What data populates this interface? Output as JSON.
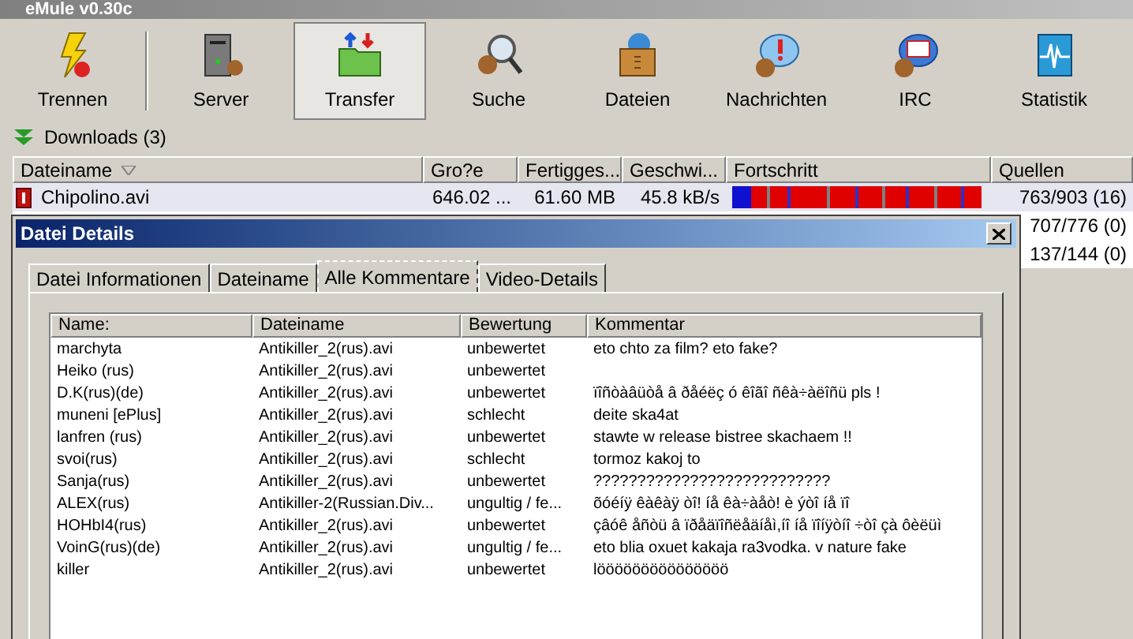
{
  "window": {
    "title": "eMule v0.30c"
  },
  "toolbar": [
    {
      "label": "Trennen",
      "selected": false
    },
    {
      "label": "Server",
      "selected": false
    },
    {
      "label": "Transfer",
      "selected": true
    },
    {
      "label": "Suche",
      "selected": false
    },
    {
      "label": "Dateien",
      "selected": false
    },
    {
      "label": "Nachrichten",
      "selected": false
    },
    {
      "label": "IRC",
      "selected": false
    },
    {
      "label": "Statistik",
      "selected": false
    }
  ],
  "downloads": {
    "label": "Downloads (3)",
    "columns": [
      "Dateiname",
      "Gro?e",
      "Fertigges...",
      "Geschwi...",
      "Fortschritt",
      "Quellen"
    ],
    "rows": [
      {
        "selected": true,
        "name": "Chipolino.avi",
        "size": "646.02 ...",
        "done": "61.60 MB",
        "speed": "45.8 kB/s",
        "sources": "763/903 (16)"
      },
      {
        "selected": false,
        "sources": "707/776 (0)"
      },
      {
        "selected": false,
        "sources": "137/144 (0)"
      }
    ]
  },
  "dialog": {
    "title": "Datei Details",
    "tabs": [
      {
        "label": "Datei Informationen",
        "selected": false
      },
      {
        "label": "Dateiname",
        "selected": false
      },
      {
        "label": "Alle Kommentare",
        "selected": true
      },
      {
        "label": "Video-Details",
        "selected": false
      }
    ],
    "columns": [
      "Name:",
      "Dateiname",
      "Bewertung",
      "Kommentar"
    ],
    "rows": [
      [
        "marchyta",
        "Antikiller_2(rus).avi",
        "unbewertet",
        "eto chto za film? eto fake?"
      ],
      [
        "Heiko (rus)",
        "Antikiller_2(rus).avi",
        "unbewertet",
        ""
      ],
      [
        "D.K(rus)(de)",
        "Antikiller_2(rus).avi",
        "unbewertet",
        "ïîñòàâüòå â ðåéëç ó êîãî ñêà÷àëîñü pls !"
      ],
      [
        "muneni [ePlus]",
        "Antikiller_2(rus).avi",
        "schlecht",
        "deite ska4at"
      ],
      [
        "lanfren (rus)",
        "Antikiller_2(rus).avi",
        "unbewertet",
        "stawte w release bistree skachaem !!"
      ],
      [
        "svoi(rus)",
        "Antikiller_2(rus).avi",
        "schlecht",
        "tormoz kakoj to"
      ],
      [
        "Sanja(rus)",
        "Antikiller_2(rus).avi",
        "unbewertet",
        "???????????????????????????"
      ],
      [
        "ALEX(rus)",
        "Antikiller-2(Russian.Div...",
        "ungultig / fe...",
        "õóéíÿ êàêàÿ òî!  íå êà÷àåò! è ýòî íå ïî"
      ],
      [
        "HOHbI4(rus)",
        "Antikiller_2(rus).avi",
        "unbewertet",
        "çâóê åñòü â ïðåäïîñëåäíåì,íî íå ïîíÿòíî ÷òî çà ôèëüì"
      ],
      [
        "VoinG(rus)(de)",
        "Antikiller_2(rus).avi",
        "ungultig / fe...",
        "eto blia oxuet kakaja ra3vodka. v nature fake"
      ],
      [
        "killer",
        "Antikiller_2(rus).avi",
        "unbewertet",
        "lööööööööööööööö"
      ]
    ]
  }
}
